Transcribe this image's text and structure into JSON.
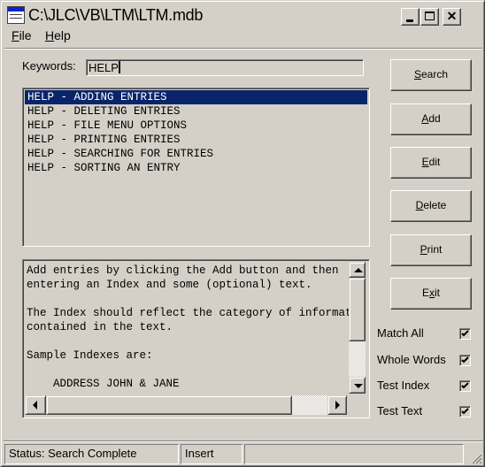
{
  "window": {
    "title": "C:\\JLC\\VB\\LTM\\LTM.mdb",
    "icon": "app-window-icon",
    "controls": {
      "minimize": "minimize-icon",
      "maximize": "maximize-icon",
      "close": "close-icon"
    },
    "close_glyph": "✕"
  },
  "menu": [
    {
      "label": "File",
      "mnemonic": "F",
      "rest": "ile"
    },
    {
      "label": "Help",
      "mnemonic": "H",
      "rest": "elp"
    }
  ],
  "search": {
    "label": "Keywords:",
    "value": "HELP"
  },
  "results": {
    "selected_index": 0,
    "items": [
      "HELP - ADDING ENTRIES",
      "HELP - DELETING ENTRIES",
      "HELP - FILE MENU OPTIONS",
      "HELP - PRINTING ENTRIES",
      "HELP - SEARCHING FOR ENTRIES",
      "HELP - SORTING AN ENTRY"
    ]
  },
  "entry_text": {
    "lines": [
      "Add entries by clicking the Add button and then",
      "entering an Index and some (optional) text.",
      "",
      "The Index should reflect the category of information",
      "contained in the text.",
      "",
      "Sample Indexes are:",
      "",
      "    ADDRESS JOHN & JANE"
    ]
  },
  "buttons": [
    {
      "id": "search",
      "mnemonic_pre": "",
      "mnemonic": "S",
      "post": "earch",
      "label": "Search"
    },
    {
      "id": "add",
      "mnemonic_pre": "",
      "mnemonic": "A",
      "post": "dd",
      "label": "Add"
    },
    {
      "id": "edit",
      "mnemonic_pre": "",
      "mnemonic": "E",
      "post": "dit",
      "label": "Edit"
    },
    {
      "id": "delete",
      "mnemonic_pre": "",
      "mnemonic": "D",
      "post": "elete",
      "label": "Delete"
    },
    {
      "id": "print",
      "mnemonic_pre": "",
      "mnemonic": "P",
      "post": "rint",
      "label": "Print"
    },
    {
      "id": "exit",
      "mnemonic_pre": "E",
      "mnemonic": "x",
      "post": "it",
      "label": "Exit"
    }
  ],
  "options": [
    {
      "label": "Match All",
      "checked": true
    },
    {
      "label": "Whole Words",
      "checked": true
    },
    {
      "label": "Test Index",
      "checked": true
    },
    {
      "label": "Test Text",
      "checked": true
    }
  ],
  "status": {
    "message": "Status: Search Complete",
    "mode": "Insert",
    "extra": ""
  },
  "colors": {
    "face": "#d4d0c8",
    "selection": "#0a246a",
    "selection_text": "#ffffff"
  }
}
